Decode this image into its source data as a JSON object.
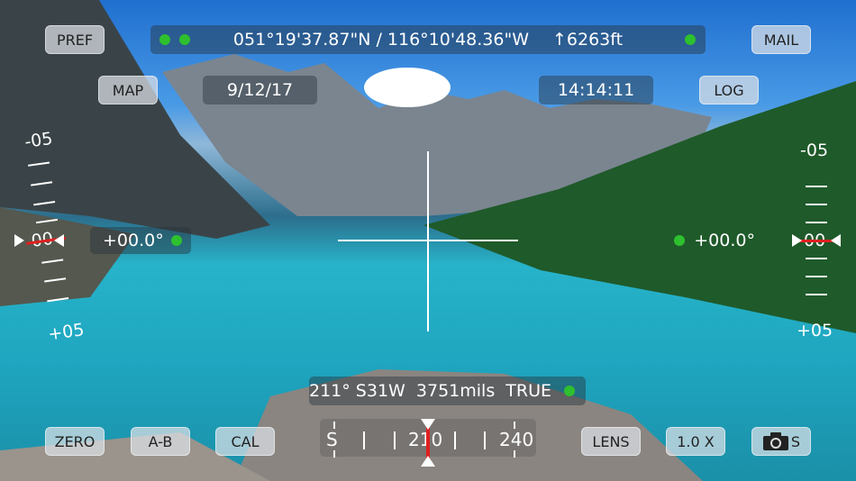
{
  "buttons": {
    "pref": "PREF",
    "mail": "MAIL",
    "map": "MAP",
    "log": "LOG",
    "zero": "ZERO",
    "ab": "A-B",
    "cal": "CAL",
    "lens": "LENS",
    "zoom": "1.0 X",
    "camera_suffix": "S"
  },
  "status": {
    "coordinates": "051°19'37.87\"N / 116°10'48.36\"W",
    "altitude": "↑6263ft",
    "date": "9/12/17",
    "time": "14:14:11"
  },
  "left_scale": {
    "top": "-05",
    "center": "00",
    "bottom": "+05",
    "readout": "+00.0°"
  },
  "right_scale": {
    "top": "-05",
    "center": "00",
    "bottom": "+05",
    "readout": "+00.0°"
  },
  "heading": {
    "text": "211° S31W  3751mils  TRUE"
  },
  "compass": {
    "labels": [
      "S",
      "210",
      "240"
    ]
  },
  "colors": {
    "status_ok": "#2ec02e",
    "indicator": "#e02020"
  }
}
